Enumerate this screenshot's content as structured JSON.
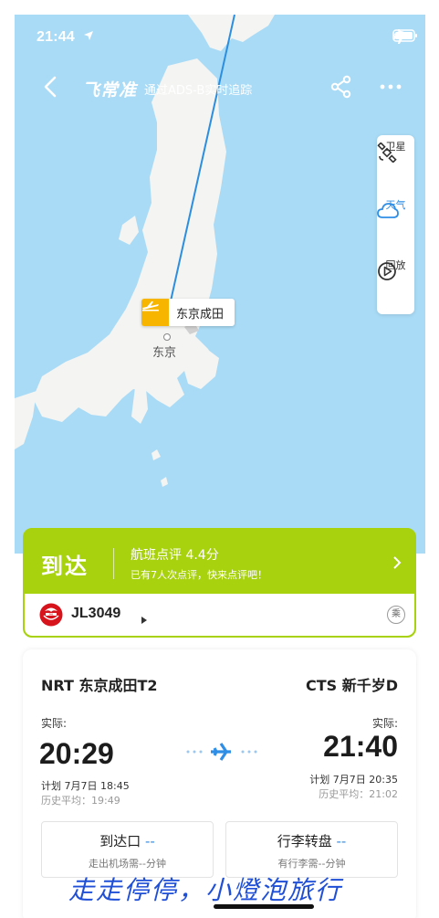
{
  "status_bar": {
    "time": "21:44"
  },
  "nav": {
    "brand": "飞常准",
    "subtitle": "通过ADS-B实时追踪"
  },
  "tools": [
    {
      "label": "卫星",
      "icon": "satellite-icon"
    },
    {
      "label": "天气",
      "icon": "cloud-icon"
    },
    {
      "label": "回放",
      "icon": "play-icon"
    }
  ],
  "map": {
    "airport_marker": "东京成田",
    "city_label": "东京"
  },
  "flight_status": {
    "state": "到达",
    "rating": "航班点评 4.4分",
    "rating_sub": "已有7人次点评，快来点评吧！",
    "flight_number": "JL3049",
    "ride_label": "乘"
  },
  "route": {
    "departure": {
      "code_name": "NRT 东京成田T2",
      "label": "实际:",
      "time": "20:29",
      "planned": "计划 7月7日 18:45",
      "history": "历史平均：19:49"
    },
    "arrival": {
      "code_name": "CTS 新千岁D",
      "label": "实际:",
      "time": "21:40",
      "planned": "计划 7月7日 20:35",
      "history": "历史平均：21:02"
    }
  },
  "info_boxes": [
    {
      "title": "到达口",
      "value": "--",
      "sub": "走出机场需--分钟"
    },
    {
      "title": "行李转盘",
      "value": "--",
      "sub": "有行李需--分钟"
    }
  ],
  "watermark": "走走停停，小燈泡旅行",
  "colors": {
    "status_green": "#a8d10e",
    "map_sea": "#a9dbf6",
    "accent_blue": "#2f8ee6",
    "marker_yellow": "#f7b500"
  }
}
